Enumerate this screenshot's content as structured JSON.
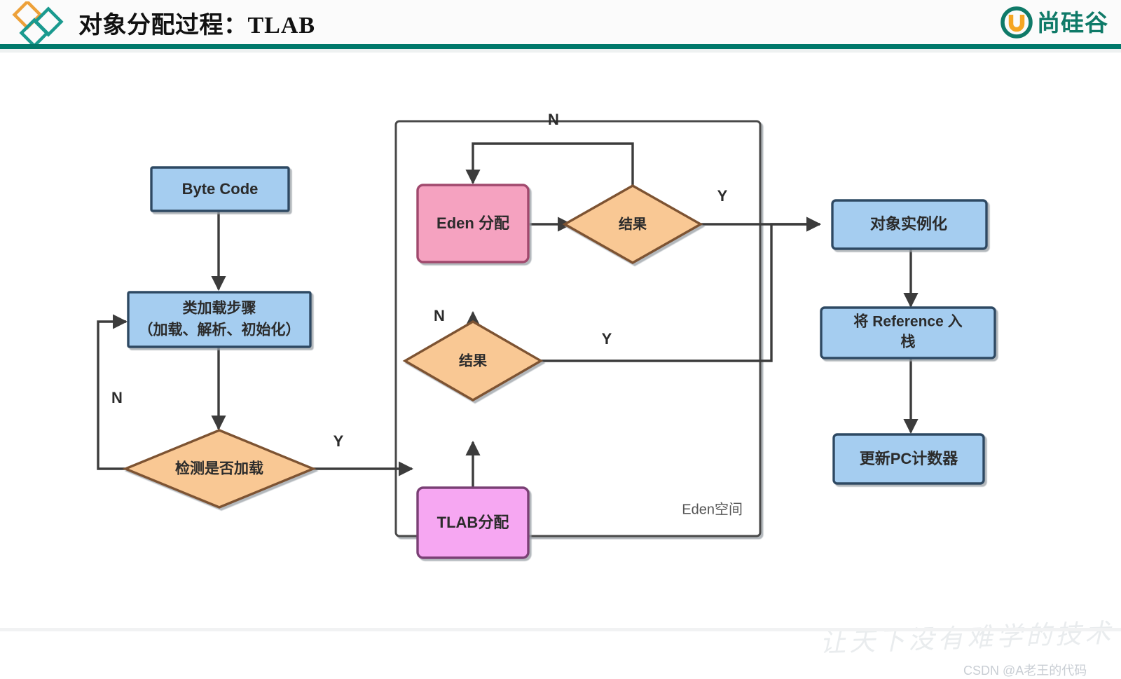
{
  "header": {
    "title_cn": "对象分配过程",
    "title_colon": "：",
    "title_latin": "TLAB",
    "brand_icon": "diamonds-logo-icon",
    "logo_mark": "u-circle-icon",
    "logo_text": "尚硅谷",
    "colors": {
      "rule": "#00796b",
      "logo_green": "#0f7a68",
      "logo_orange": "#f5a623",
      "diamond_orange": "#eda13a",
      "diamond_teal": "#1a9a8f"
    }
  },
  "diagram": {
    "title": "对象分配过程：TLAB",
    "type": "flowchart",
    "colors": {
      "process_blue_fill": "#a5cdf0",
      "process_blue_stroke": "#2f4a63",
      "decision_orange_fill": "#f9c894",
      "decision_orange_stroke": "#7d5230",
      "eden_pink_fill": "#f5a2c0",
      "eden_pink_stroke": "#a0486d",
      "tlab_magenta_fill": "#f6a7f2",
      "tlab_magenta_stroke": "#7a3f74",
      "link_stroke": "#3c3c3c",
      "container_stroke": "#4a4a4a"
    },
    "container": {
      "label": "Eden空间",
      "shape": "rectangle"
    },
    "nodes": [
      {
        "id": "byte-code",
        "label": "Byte Code",
        "shape": "process",
        "color": "blue"
      },
      {
        "id": "class-load",
        "label": "类加载步骤",
        "label2": "（加载、解析、初始化）",
        "shape": "process",
        "color": "blue"
      },
      {
        "id": "check-loaded",
        "label": "检测是否加载",
        "shape": "decision",
        "color": "orange"
      },
      {
        "id": "tlab-alloc",
        "label": "TLAB分配",
        "shape": "process",
        "color": "magenta"
      },
      {
        "id": "tlab-result",
        "label": "结果",
        "shape": "decision",
        "color": "orange"
      },
      {
        "id": "eden-alloc",
        "label": "Eden 分配",
        "shape": "process",
        "color": "pink"
      },
      {
        "id": "eden-result",
        "label": "结果",
        "shape": "decision",
        "color": "orange"
      },
      {
        "id": "instantiate",
        "label": "对象实例化",
        "shape": "process",
        "color": "blue"
      },
      {
        "id": "push-ref",
        "label": "将 Reference 入",
        "label2": "栈",
        "shape": "process",
        "color": "blue"
      },
      {
        "id": "update-pc",
        "label": "更新PC计数器",
        "shape": "process",
        "color": "blue"
      }
    ],
    "edges": [
      {
        "from": "byte-code",
        "to": "class-load",
        "label": ""
      },
      {
        "from": "class-load",
        "to": "check-loaded",
        "label": ""
      },
      {
        "from": "check-loaded",
        "to": "class-load",
        "label": "N"
      },
      {
        "from": "check-loaded",
        "to": "tlab-alloc",
        "label": "Y"
      },
      {
        "from": "tlab-alloc",
        "to": "tlab-result",
        "label": ""
      },
      {
        "from": "tlab-result",
        "to": "eden-alloc",
        "label": "N"
      },
      {
        "from": "tlab-result",
        "to": "instantiate",
        "label": "Y"
      },
      {
        "from": "eden-alloc",
        "to": "eden-result",
        "label": ""
      },
      {
        "from": "eden-result",
        "to": "eden-alloc",
        "label": "N"
      },
      {
        "from": "eden-result",
        "to": "instantiate",
        "label": "Y"
      },
      {
        "from": "instantiate",
        "to": "push-ref",
        "label": ""
      },
      {
        "from": "push-ref",
        "to": "update-pc",
        "label": ""
      }
    ],
    "edge_labels": {
      "check_n": "N",
      "check_y": "Y",
      "tlab_n": "N",
      "tlab_y": "Y",
      "eden_n": "N",
      "eden_y": "Y"
    }
  },
  "watermark": {
    "slogan": "让天下没有难学的技术",
    "csdn": "CSDN @A老王的代码"
  }
}
